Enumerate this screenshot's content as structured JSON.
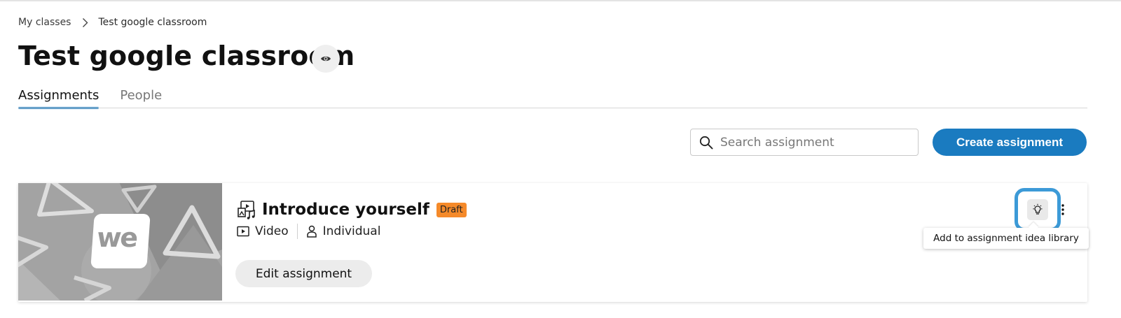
{
  "breadcrumb": {
    "items": [
      "My classes",
      "Test google classroom"
    ]
  },
  "page": {
    "title": "Test google classroom"
  },
  "tabs": [
    {
      "label": "Assignments",
      "active": true
    },
    {
      "label": "People",
      "active": false
    }
  ],
  "toolbar": {
    "search_placeholder": "Search assignment",
    "create_label": "Create assignment"
  },
  "assignment": {
    "title": "Introduce yourself",
    "status": "Draft",
    "type": "Video",
    "mode": "Individual",
    "edit_label": "Edit assignment",
    "thumbnail_logo": "we"
  },
  "tooltip": {
    "text": "Add to assignment idea library"
  },
  "icons": {
    "breadcrumb_separator": "chevron-right-icon",
    "visibility": "eye-icon",
    "search": "search-icon",
    "assignment_type": "media-assignment-icon",
    "video": "video-icon",
    "individual": "person-icon",
    "idea": "lightbulb-icon",
    "more": "more-vertical-icon"
  },
  "colors": {
    "accent": "#1a7bc0",
    "draft_badge": "#f58a2a",
    "focus_ring": "#3c9ad7"
  }
}
